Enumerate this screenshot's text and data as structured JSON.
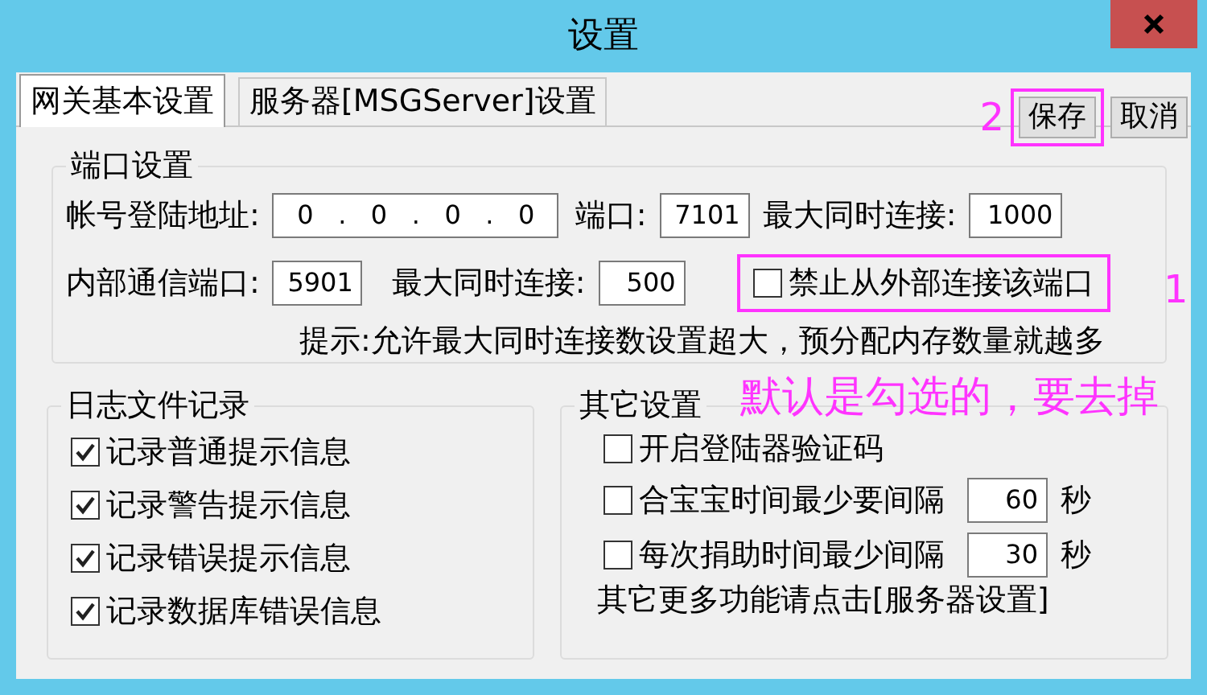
{
  "window": {
    "title": "设置"
  },
  "tabs": [
    {
      "label": "网关基本设置",
      "selected": true
    },
    {
      "label": "服务器[MSGServer]设置",
      "selected": false
    }
  ],
  "buttons": [
    {
      "label": "保存",
      "annotated": true
    },
    {
      "label": "取消",
      "annotated": false
    }
  ],
  "port_settings": {
    "title": "端口设置",
    "rows": [
      {
        "items": [
          {
            "kind": "label",
            "text": "帐号登陆地址:"
          },
          {
            "kind": "ip",
            "value": "0   .   0   .   0   .   0"
          },
          {
            "kind": "label",
            "text": "端口:"
          },
          {
            "kind": "field",
            "value": "7101"
          },
          {
            "kind": "label",
            "text": "最大同时连接:"
          },
          {
            "kind": "field",
            "value": "1000"
          }
        ]
      },
      {
        "items": [
          {
            "kind": "label",
            "text": "内部通信端口:"
          },
          {
            "kind": "field",
            "value": "5901"
          },
          {
            "kind": "label",
            "text": "最大同时连接:"
          },
          {
            "kind": "field",
            "value": "500"
          },
          {
            "kind": "checkbox",
            "label": "禁止从外部连接该端口",
            "checked": false,
            "annotated": true
          }
        ]
      }
    ],
    "hint": "提示:允许最大同时连接数设置超大，预分配内存数量就越多"
  },
  "log_settings": {
    "title": "日志文件记录",
    "items": [
      {
        "label": "记录普通提示信息",
        "checked": true
      },
      {
        "label": "记录警告提示信息",
        "checked": true
      },
      {
        "label": "记录错误提示信息",
        "checked": true
      },
      {
        "label": "记录数据库错误信息",
        "checked": true
      }
    ]
  },
  "other_settings": {
    "title": "其它设置",
    "items": [
      {
        "kind": "checkbox",
        "label": "开启登陆器验证码",
        "checked": false
      },
      {
        "kind": "interval",
        "label": "合宝宝时间最少要间隔",
        "checked": false,
        "value": "60",
        "unit": "秒"
      },
      {
        "kind": "interval",
        "label": "每次捐助时间最少间隔",
        "checked": false,
        "value": "30",
        "unit": "秒"
      }
    ],
    "note": "其它更多功能请点击[服务器设置]"
  },
  "annotations": [
    {
      "text": "2"
    },
    {
      "text": "1"
    },
    {
      "text": "默认是勾选的，要去掉"
    }
  ]
}
